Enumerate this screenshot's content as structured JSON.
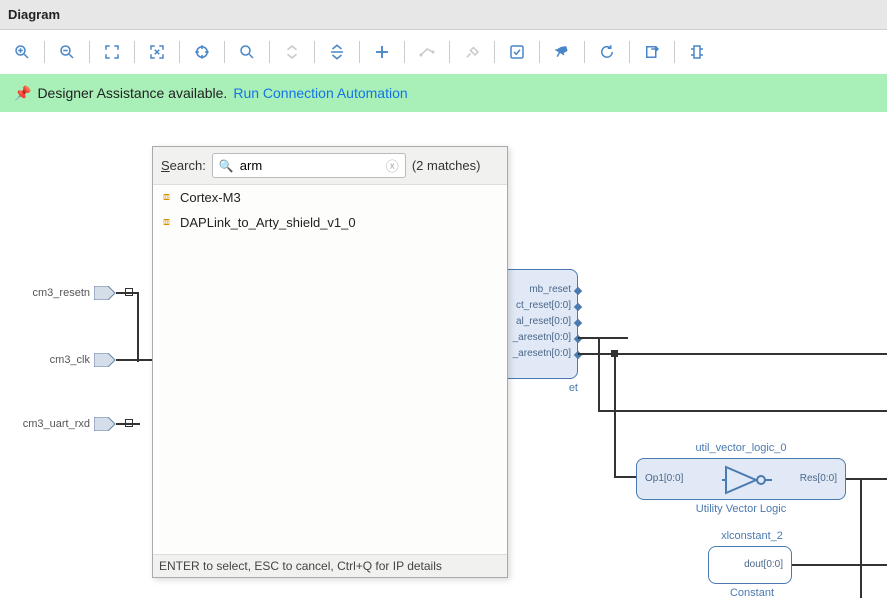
{
  "title": "Diagram",
  "info_bar": {
    "message": "Designer Assistance available.",
    "link": "Run Connection Automation"
  },
  "toolbar": {
    "zoom_in": "zoom-in",
    "zoom_out": "zoom-out",
    "fit": "fit",
    "fit_sel": "fit-select",
    "center": "center",
    "find": "find",
    "collapse": "collapse",
    "expand": "expand",
    "add": "add",
    "link": "link",
    "wrench": "wrench",
    "validate": "validate",
    "pin": "pin",
    "refresh": "refresh",
    "export": "export",
    "layout": "layout"
  },
  "ports": {
    "p1": "cm3_resetn",
    "p2": "cm3_clk",
    "p3": "cm3_uart_rxd"
  },
  "reset_block": {
    "sig1": "mb_reset",
    "sig2": "ct_reset[0:0]",
    "sig3": "al_reset[0:0]",
    "sig4": "_aresetn[0:0]",
    "sig5": "_aresetn[0:0]",
    "footer": "et"
  },
  "logic_block": {
    "title": "util_vector_logic_0",
    "in": "Op1[0:0]",
    "out": "Res[0:0]",
    "footer": "Utility Vector Logic"
  },
  "const_block": {
    "title": "xlconstant_2",
    "out": "dout[0:0]",
    "footer": "Constant"
  },
  "popup": {
    "search_label_pre": "S",
    "search_label_post": "earch:",
    "search_value": "arm",
    "matches": "(2 matches)",
    "items": [
      "Cortex-M3",
      "DAPLink_to_Arty_shield_v1_0"
    ],
    "footer": "ENTER to select, ESC to cancel, Ctrl+Q for IP details"
  }
}
